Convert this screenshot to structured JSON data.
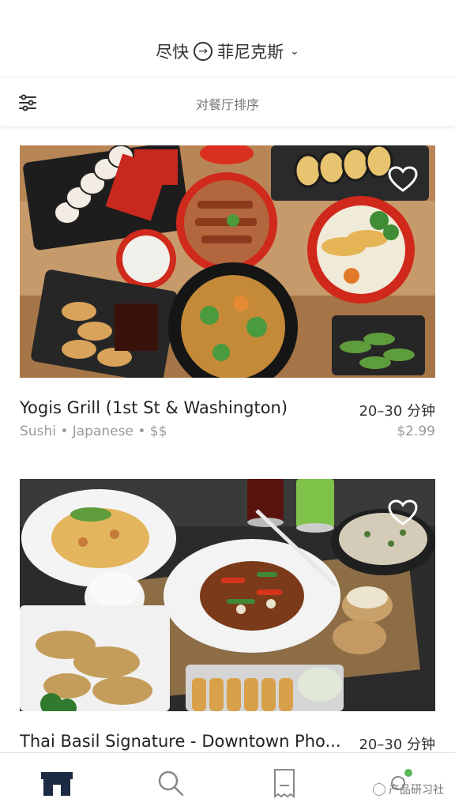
{
  "header": {
    "time_label": "尽快",
    "city": "菲尼克斯"
  },
  "sortbar": {
    "label": "对餐厅排序"
  },
  "restaurants": [
    {
      "name": "Yogis Grill (1st St & Washington)",
      "tags": "Sushi • Japanese • $$",
      "time": "20–30 分钟",
      "fee": "$2.99"
    },
    {
      "name": "Thai Basil Signature - Downtown Pho...",
      "time": "20–30 分钟"
    }
  ],
  "tabs": [
    "home-icon",
    "search-icon",
    "orders-icon",
    "account-icon"
  ],
  "watermark": "产品研习社",
  "colors": {
    "primary_dark": "#1c2a44",
    "notification_dot": "#5bb955",
    "text_muted": "#999999"
  }
}
